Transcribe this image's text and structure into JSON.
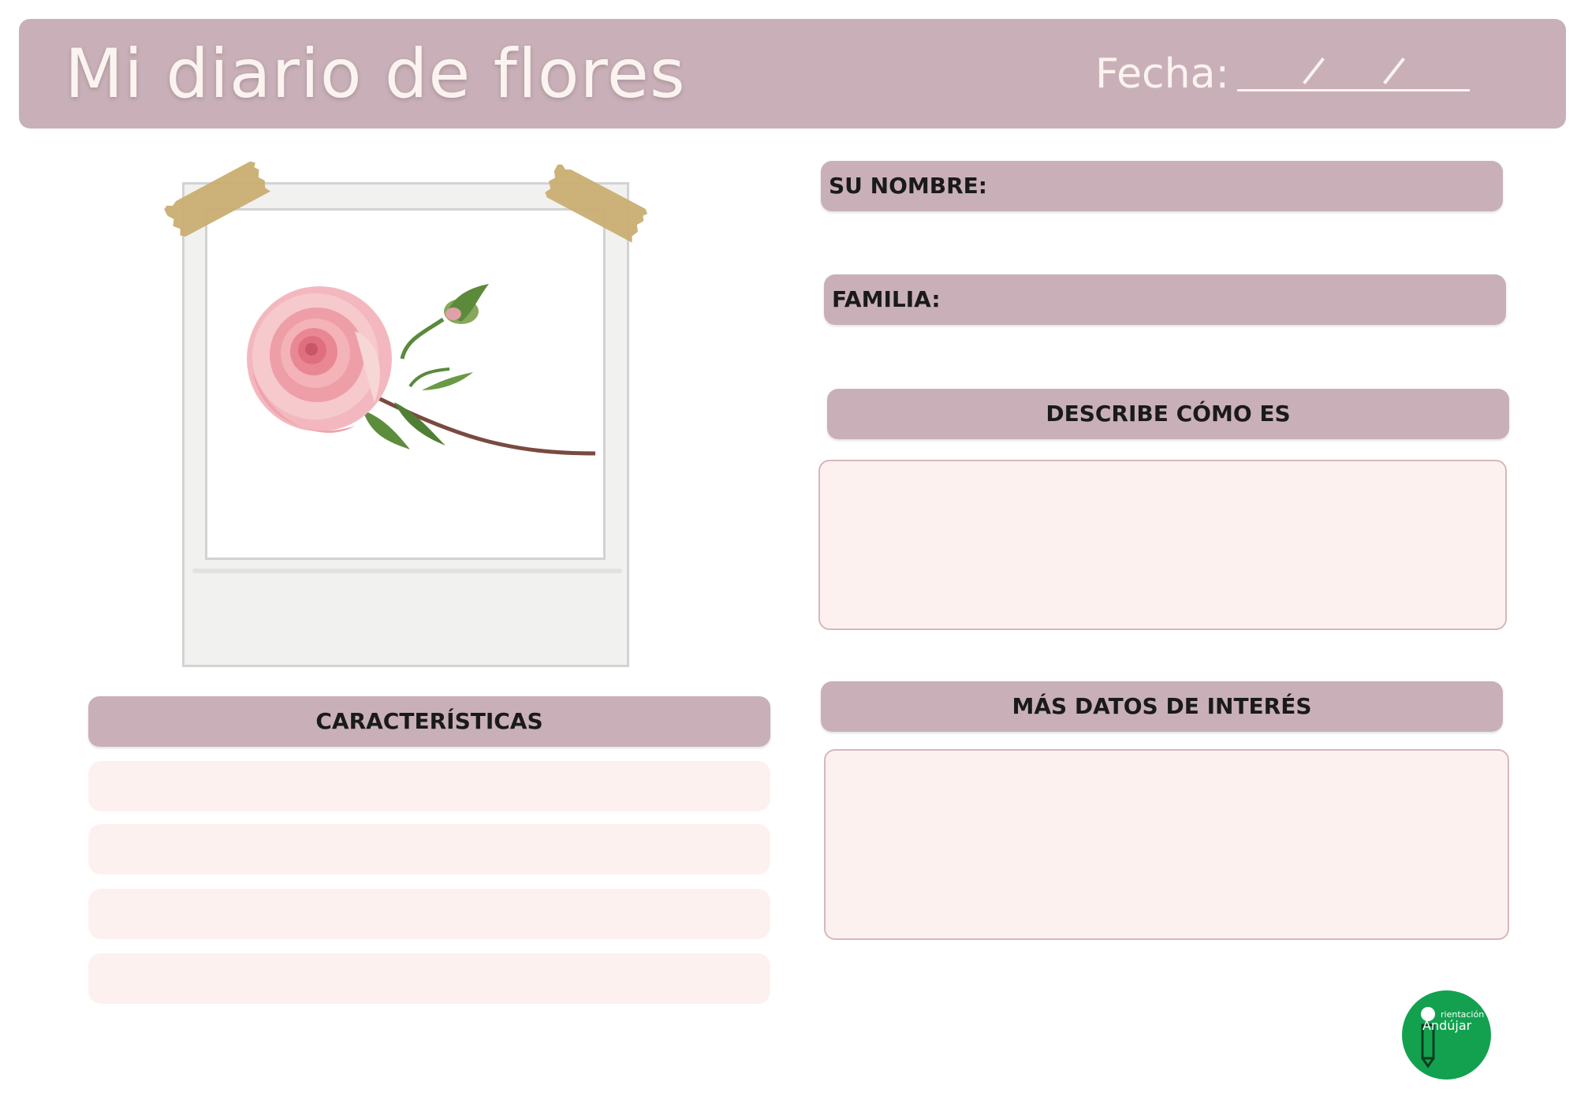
{
  "header": {
    "title": "Mi diario de flores",
    "date_label": "Fecha:"
  },
  "sections": {
    "name_label": "SU NOMBRE:",
    "family_label": "FAMILIA:",
    "describe_label": "DESCRIBE CÓMO ES",
    "characteristics_label": "CARACTERÍSTICAS",
    "more_data_label": "MÁS DATOS DE INTERÉS"
  },
  "photo": {
    "subject": "pink rose"
  },
  "logo": {
    "small_text": "rientación",
    "name": "Andújar"
  },
  "colors": {
    "header_bar": "#c9b0b8",
    "box_fill": "#fdf1ef",
    "logo_green": "#13a150",
    "tape": "#c9ae72"
  }
}
